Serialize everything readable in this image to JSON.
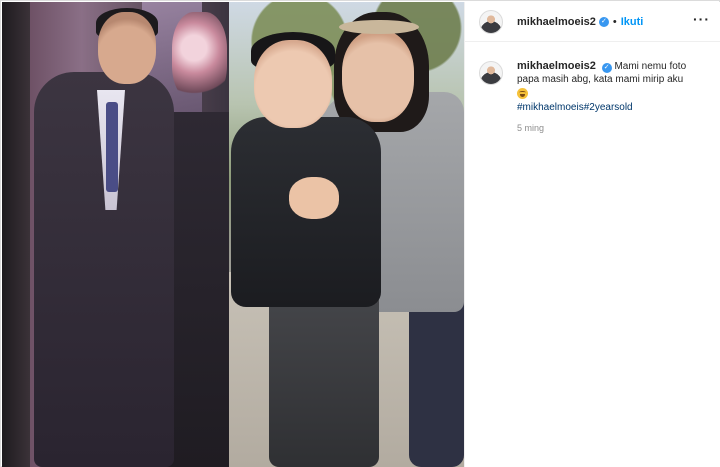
{
  "post": {
    "username": "mikhaelmoeis2",
    "separator": "•",
    "follow_label": "Ikuti",
    "more_icon": "more-horizontal-icon"
  },
  "caption": {
    "username": "mikhaelmoeis2",
    "text": "Mami nemu foto papa masih abg, kata mami mirip aku",
    "emoji": "grinning-sweat-emoji",
    "hashtags": "#mikhaelmoeis#2yearsold",
    "time": "5 ming"
  },
  "colors": {
    "link_blue": "#0095f6",
    "verified_blue": "#3897f0",
    "hashtag": "#00376b",
    "muted": "#8e8e8e"
  }
}
